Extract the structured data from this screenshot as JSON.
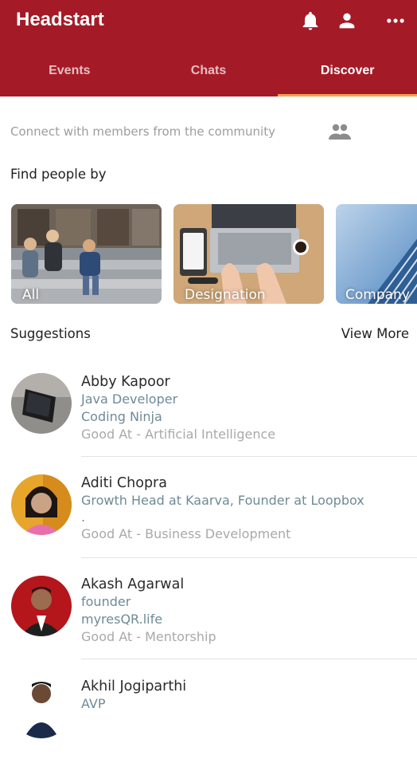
{
  "header": {
    "title": "Headstart",
    "icons": [
      "bell-icon",
      "account-icon",
      "more-horizontal-icon"
    ],
    "background_color": "#a51a27"
  },
  "tabs": [
    {
      "label": "Events",
      "active": false
    },
    {
      "label": "Chats",
      "active": false
    },
    {
      "label": "Discover",
      "active": true
    }
  ],
  "discover": {
    "intro_text": "Connect with members from the community",
    "find_label": "Find people by",
    "categories": [
      {
        "label": "All",
        "icon": "group-photo"
      },
      {
        "label": "Designation",
        "icon": "laptop-desk-photo"
      },
      {
        "label": "Company",
        "icon": "building-photo"
      }
    ],
    "suggestions_label": "Suggestions",
    "view_more_label": "View More",
    "people": [
      {
        "name": "Abby Kapoor",
        "lines": [
          "Java Developer",
          "Coding Ninja"
        ],
        "good_at": "Good At - Artificial Intelligence"
      },
      {
        "name": "Aditi Chopra",
        "lines": [
          "Growth Head at Kaarva, Founder at Loopbox",
          "."
        ],
        "good_at": "Good At - Business Development"
      },
      {
        "name": "Akash Agarwal",
        "lines": [
          "founder",
          "myresQR.life"
        ],
        "good_at": "Good At - Mentorship"
      },
      {
        "name": "Akhil Jogiparthi",
        "lines": [
          "AVP"
        ],
        "good_at": ""
      }
    ]
  },
  "accent_color": "#f3a24a"
}
